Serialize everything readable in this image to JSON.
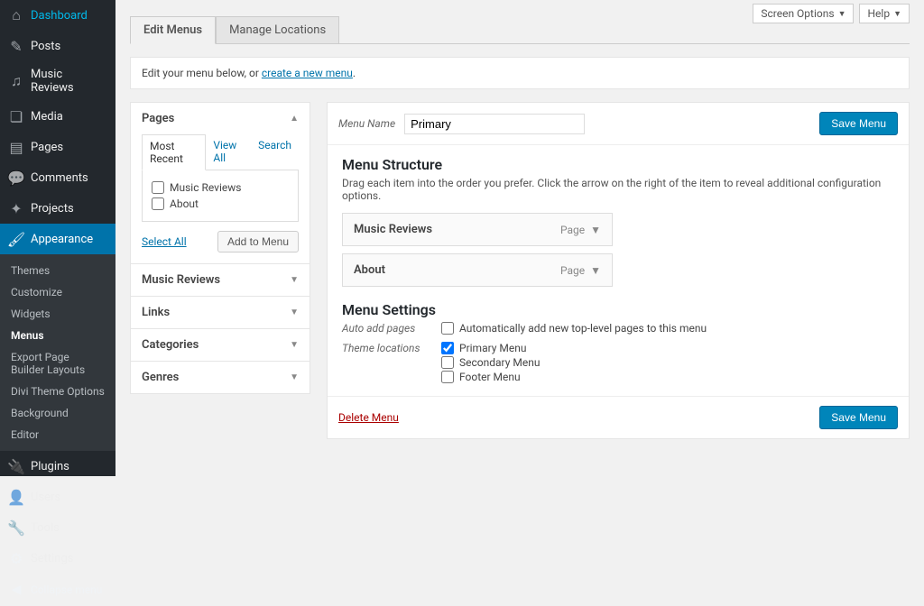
{
  "topbar": {
    "screen_options": "Screen Options",
    "help": "Help"
  },
  "sidebar": {
    "items": [
      {
        "label": "Dashboard",
        "icon": "⌂"
      },
      {
        "label": "Posts",
        "icon": "✎"
      },
      {
        "label": "Music Reviews",
        "icon": "♫"
      },
      {
        "label": "Media",
        "icon": "❏"
      },
      {
        "label": "Pages",
        "icon": "▤"
      },
      {
        "label": "Comments",
        "icon": "💬"
      },
      {
        "label": "Projects",
        "icon": "✦"
      },
      {
        "label": "Appearance",
        "icon": "🖌"
      },
      {
        "label": "Plugins",
        "icon": "🔌"
      },
      {
        "label": "Users",
        "icon": "👤"
      },
      {
        "label": "Tools",
        "icon": "🔧"
      },
      {
        "label": "Settings",
        "icon": "⚙"
      }
    ],
    "appearance_sub": [
      "Themes",
      "Customize",
      "Widgets",
      "Menus",
      "Export Page Builder Layouts",
      "Divi Theme Options",
      "Background",
      "Editor"
    ],
    "collapse": "Collapse menu"
  },
  "tabs": {
    "edit": "Edit Menus",
    "manage": "Manage Locations"
  },
  "notice": {
    "prefix": "Edit your menu below, or ",
    "link": "create a new menu",
    "suffix": "."
  },
  "pages_box": {
    "title": "Pages",
    "tabs": {
      "recent": "Most Recent",
      "view_all": "View All",
      "search": "Search"
    },
    "items": [
      "Music Reviews",
      "About"
    ],
    "select_all": "Select All",
    "add_btn": "Add to Menu"
  },
  "other_boxes": [
    "Music Reviews",
    "Links",
    "Categories",
    "Genres"
  ],
  "menu": {
    "name_label": "Menu Name",
    "name_value": "Primary",
    "save": "Save Menu",
    "structure_title": "Menu Structure",
    "structure_desc": "Drag each item into the order you prefer. Click the arrow on the right of the item to reveal additional configuration options.",
    "items": [
      {
        "label": "Music Reviews",
        "type": "Page"
      },
      {
        "label": "About",
        "type": "Page"
      }
    ],
    "settings_title": "Menu Settings",
    "auto_label": "Auto add pages",
    "auto_text": "Automatically add new top-level pages to this menu",
    "theme_label": "Theme locations",
    "locations": [
      {
        "label": "Primary Menu",
        "checked": true
      },
      {
        "label": "Secondary Menu",
        "checked": false
      },
      {
        "label": "Footer Menu",
        "checked": false
      }
    ],
    "delete": "Delete Menu"
  }
}
